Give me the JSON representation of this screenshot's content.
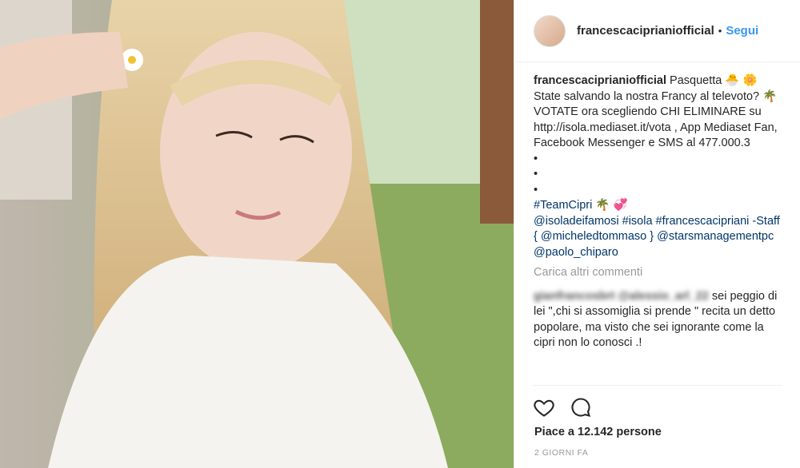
{
  "post": {
    "username": "francescaciprianiofficial",
    "follow_label": "Segui",
    "caption_user": "francescaciprianiofficial",
    "caption_lines": [
      " Pasquetta 🐣 🌼",
      "State salvando la nostra Francy al televoto? 🌴",
      "VOTATE ora scegliendo CHI ELIMINARE su http://isola.mediaset.it/vota , App Mediaset Fan, Facebook Messenger e SMS al 477.000.3",
      "•",
      "•",
      "•"
    ],
    "hashtags": "#TeamCipri 🌴 💞",
    "mentions": "@isoladeifamosi #isola #francescacipriani -Staff { @micheledtommaso } @starsmanagementpc @paolo_chiparo",
    "load_more": "Carica altri commenti",
    "comment_user": "gianfrancosbrt @alessio_arl_22",
    "comment_text": " sei peggio di lei \",chi si assomiglia si prende \" recita un detto popolare, ma visto che sei ignorante come la cipri non lo conosci .!",
    "likes": "Piace a 12.142 persone",
    "time": "2 GIORNI FA"
  },
  "icons": {
    "like": "heart-icon",
    "comment": "comment-icon"
  },
  "colors": {
    "link": "#3897f0",
    "hashtag": "#003569",
    "muted": "#999999"
  }
}
